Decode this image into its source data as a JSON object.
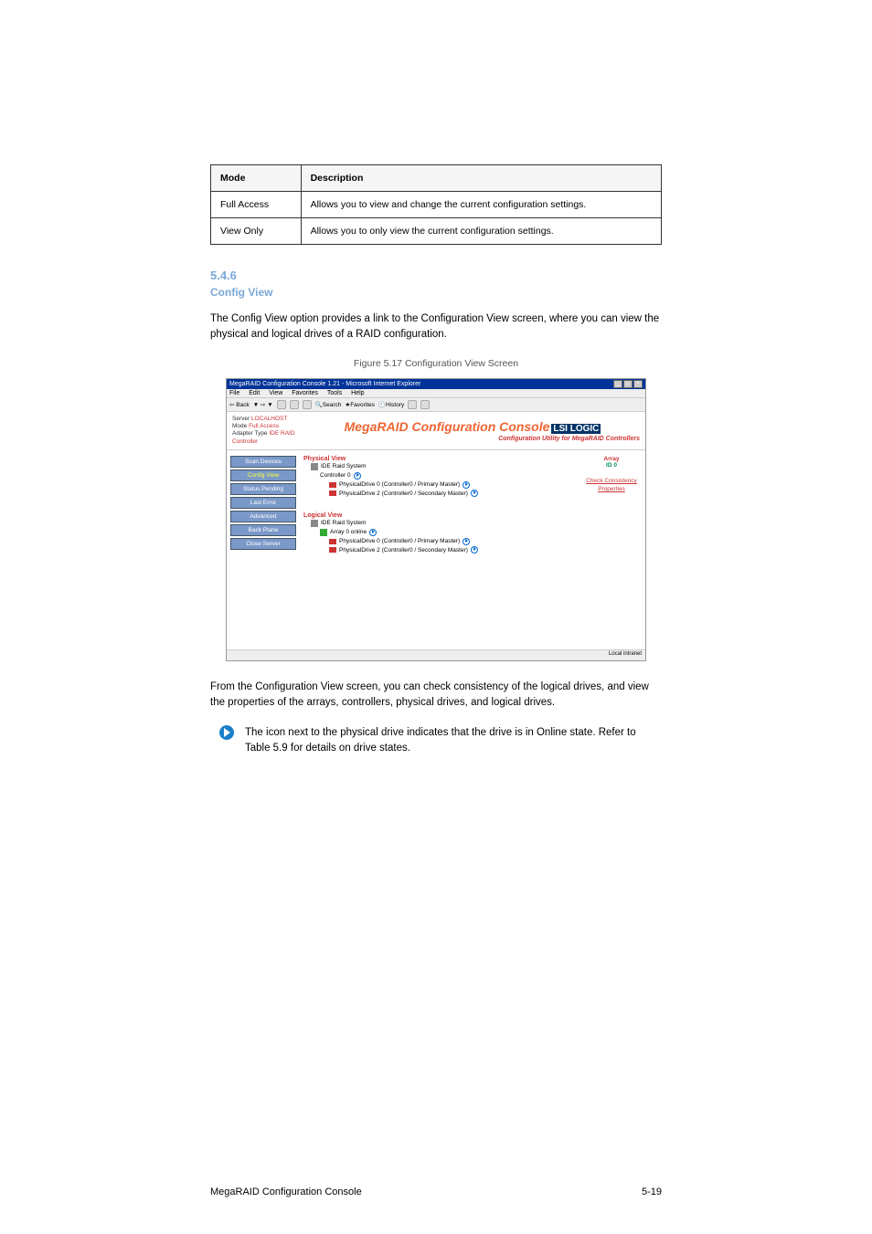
{
  "table": {
    "headers": [
      "Mode",
      "Description"
    ],
    "rows": [
      [
        "Full Access",
        "Allows you to view and change the current configuration settings."
      ],
      [
        "View Only",
        "Allows you to only view the current configuration settings."
      ]
    ]
  },
  "section": {
    "num": "5.4.6",
    "title": "Config View"
  },
  "paragraphs": {
    "p1": "The Config View option provides a link to the Configuration View screen, where you can view the physical and logical drives of a RAID configuration.",
    "p2": "From the Configuration View screen, you can check consistency of the logical drives, and view the properties of the arrays, controllers, physical drives, and logical drives."
  },
  "caption": "Figure 5.17 Configuration View Screen",
  "note": "The icon next to the physical drive indicates that the drive is in Online state. Refer to Table 5.9 for details on drive states.",
  "footer": {
    "left": "MegaRAID Configuration Console",
    "right": "5-19"
  },
  "screenshot": {
    "titlebar": "MegaRAID Configuration Console 1.21 - Microsoft Internet Explorer",
    "menubar": [
      "File",
      "Edit",
      "View",
      "Favorites",
      "Tools",
      "Help"
    ],
    "toolbar": {
      "back": "Back",
      "search": "Search",
      "favorites": "Favorites",
      "history": "History"
    },
    "hostinfo": {
      "server_label": "Server",
      "server_value": "LOCALHOST",
      "mode_label": "Mode",
      "mode_value": "Full Access",
      "adapter_label": "Adapter Type",
      "adapter_value": "IDE RAID Controller"
    },
    "brand": {
      "title": "MegaRAID Configuration Console",
      "vendor": "LSI LOGIC",
      "subtitle": "Configuration Utility for MegaRAID Controllers"
    },
    "sidebar": [
      "Scan Devices",
      "Config View",
      "Status Pending",
      "Last Error",
      "Advanced",
      "Back Plane",
      "Close Server"
    ],
    "sidebar_active_index": 1,
    "right": {
      "array_label": "Array",
      "array_value": "ID 0",
      "link1": "Check Consistency",
      "link2": "Properties"
    },
    "physical": {
      "label": "Physical View",
      "system": "IDE Raid System",
      "controller": "Controller 0",
      "drive0": "PhysicalDrive 0 (Controller0 / Primary Master)",
      "drive2": "PhysicalDrive 2 (Controller0 / Secondary Master)"
    },
    "logical": {
      "label": "Logical View",
      "system": "IDE Raid System",
      "array": "Array 0 online",
      "drive0": "PhysicalDrive 0 (Controller0 / Primary Master)",
      "drive2": "PhysicalDrive 2 (Controller0 / Secondary Master)"
    },
    "status_intranet": "Local intranet"
  }
}
